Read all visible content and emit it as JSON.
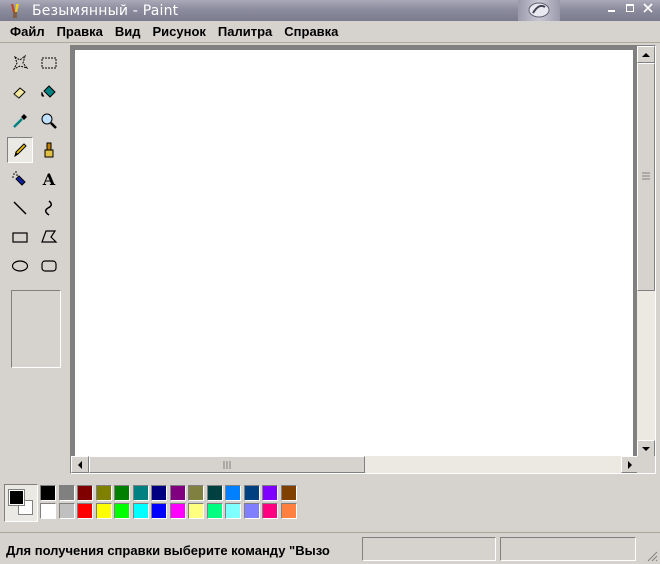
{
  "window": {
    "title": "Безымянный - Paint"
  },
  "menu": {
    "items": [
      "Файл",
      "Правка",
      "Вид",
      "Рисунок",
      "Палитра",
      "Справка"
    ]
  },
  "toolbox": {
    "tools": [
      {
        "name": "free-form-select-icon"
      },
      {
        "name": "select-icon"
      },
      {
        "name": "eraser-icon"
      },
      {
        "name": "fill-bucket-icon"
      },
      {
        "name": "color-picker-icon"
      },
      {
        "name": "magnifier-icon"
      },
      {
        "name": "pencil-icon",
        "active": true
      },
      {
        "name": "brush-icon"
      },
      {
        "name": "airbrush-icon"
      },
      {
        "name": "text-icon"
      },
      {
        "name": "line-icon"
      },
      {
        "name": "curve-icon"
      },
      {
        "name": "rectangle-icon"
      },
      {
        "name": "polygon-icon"
      },
      {
        "name": "ellipse-icon"
      },
      {
        "name": "rounded-rectangle-icon"
      }
    ],
    "text_tool_glyph": "A"
  },
  "palette": {
    "foreground": "#000000",
    "background": "#ffffff",
    "top_row": [
      "#000000",
      "#808080",
      "#800000",
      "#808000",
      "#008000",
      "#008080",
      "#000080",
      "#800080",
      "#808040",
      "#004040",
      "#0080ff",
      "#004080",
      "#8000ff",
      "#804000"
    ],
    "bottom_row": [
      "#ffffff",
      "#c0c0c0",
      "#ff0000",
      "#ffff00",
      "#00ff00",
      "#00ffff",
      "#0000ff",
      "#ff00ff",
      "#ffff80",
      "#00ff80",
      "#80ffff",
      "#8080ff",
      "#ff0080",
      "#ff8040"
    ]
  },
  "status": {
    "text": "Для получения справки выберите команду \"Вызо"
  }
}
